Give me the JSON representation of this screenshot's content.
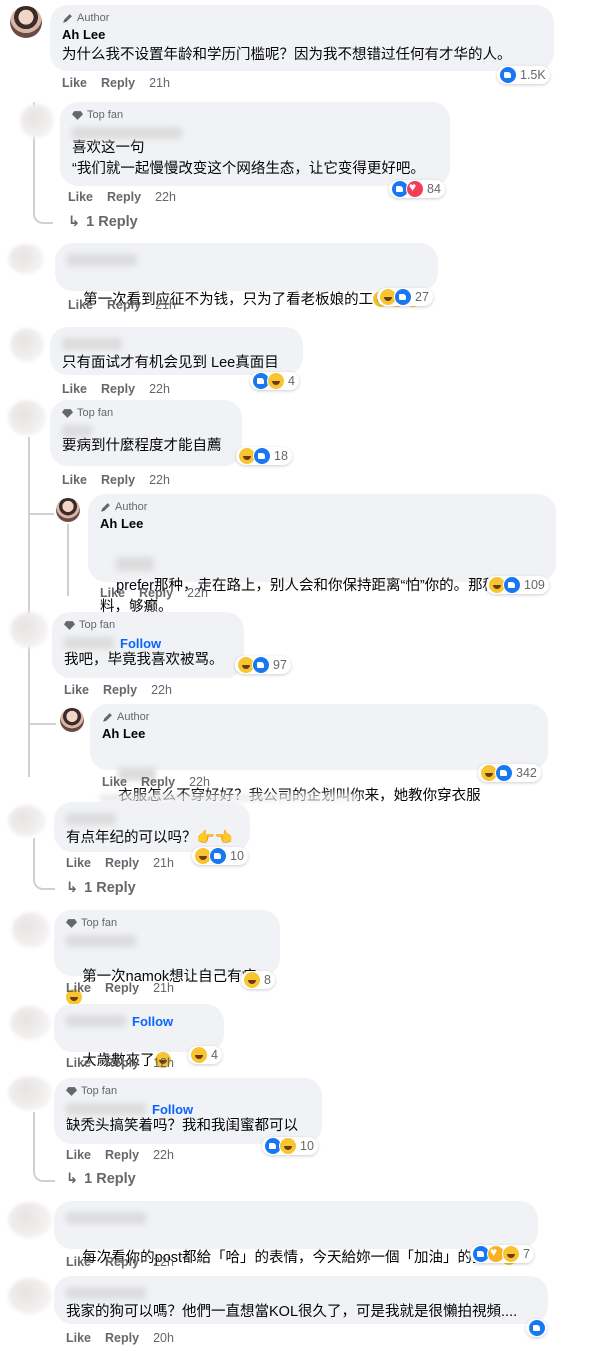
{
  "labels": {
    "author": "Author",
    "top_fan": "Top fan",
    "like": "Like",
    "reply": "Reply",
    "follow": "Follow",
    "author_name": "Ah Lee"
  },
  "colors": {
    "accent": "#0866ff",
    "bubble": "#f0f2f5",
    "meta": "#65676b",
    "like_blue": "#1877f2",
    "haha_yellow": "#f7c531",
    "love_red": "#f33e58"
  },
  "comments": [
    {
      "badge": "Author",
      "name": "Ah Lee",
      "text": "为什么我不设置年龄和学历门槛呢？因为我不想错过任何有才华的人。",
      "time": "21h",
      "reactions": [
        "like-icon"
      ],
      "count": "1.5K"
    },
    {
      "badge": "Top fan",
      "text": "喜欢这一句\n“我们就一起慢慢改变这个网络生态，让它变得更好吧。",
      "time": "22h",
      "reactions": [
        "like-icon",
        "love-icon"
      ],
      "count": "84",
      "replies": "1 Reply"
    },
    {
      "text": "第一次看到应征不为钱，只为了看老板娘的工",
      "time": "21h",
      "reactions": [
        "haha-icon",
        "like-icon"
      ],
      "count": "27"
    },
    {
      "text": "只有面试才有机会见到 Lee真面目",
      "time": "22h",
      "reactions": [
        "like-icon",
        "haha-icon"
      ],
      "count": "4"
    },
    {
      "badge": "Top fan",
      "text": "要病到什麼程度才能自薦",
      "time": "22h",
      "reactions": [
        "haha-icon",
        "like-icon"
      ],
      "count": "18"
    },
    {
      "badge": "Author",
      "name": "Ah Lee",
      "text": "prefer那种，走在路上，别人会和你保持距离“怕”你的。那种就好料，够癫。",
      "time": "22h",
      "reactions": [
        "haha-icon",
        "like-icon"
      ],
      "count": "109"
    },
    {
      "badge": "Top fan",
      "follow": "Follow",
      "text": "我吧，毕竟我喜欢被骂。",
      "time": "22h",
      "reactions": [
        "haha-icon",
        "like-icon"
      ],
      "count": "97"
    },
    {
      "badge": "Author",
      "name": "Ah Lee",
      "text": "衣服怎么不穿好好？我公司的企划叫你来，她教你穿衣服",
      "time": "22h",
      "reactions": [
        "haha-icon",
        "like-icon"
      ],
      "count": "342"
    },
    {
      "text": "有点年纪的可以吗？👉👈",
      "time": "21h",
      "reactions": [
        "haha-icon",
        "like-icon"
      ],
      "count": "10",
      "replies": "1 Reply"
    },
    {
      "badge": "Top fan",
      "text": "第一次namok想让自己有病",
      "time": "21h",
      "reactions": [
        "haha-icon"
      ],
      "count": "8"
    },
    {
      "follow": "Follow",
      "text": "大歲數來了",
      "time": "12h",
      "reactions": [
        "haha-icon"
      ],
      "count": "4"
    },
    {
      "badge": "Top fan",
      "follow": "Follow",
      "text": "缺秃头搞笑着吗？我和我闺蜜都可以",
      "time": "22h",
      "reactions": [
        "like-icon",
        "haha-icon"
      ],
      "count": "10",
      "replies": "1 Reply"
    },
    {
      "text": "每次看你的post都給「哈」的表情，今天給妳一個「加油」的抱抱",
      "time": "22h",
      "reactions": [
        "like-icon",
        "care-icon",
        "haha-icon"
      ],
      "count": "7"
    },
    {
      "text": "我家的狗可以嗎？他們一直想當KOL很久了，可是我就是很懶拍視頻....",
      "time": "20h",
      "reactions": [
        "like-icon"
      ],
      "count": ""
    }
  ]
}
